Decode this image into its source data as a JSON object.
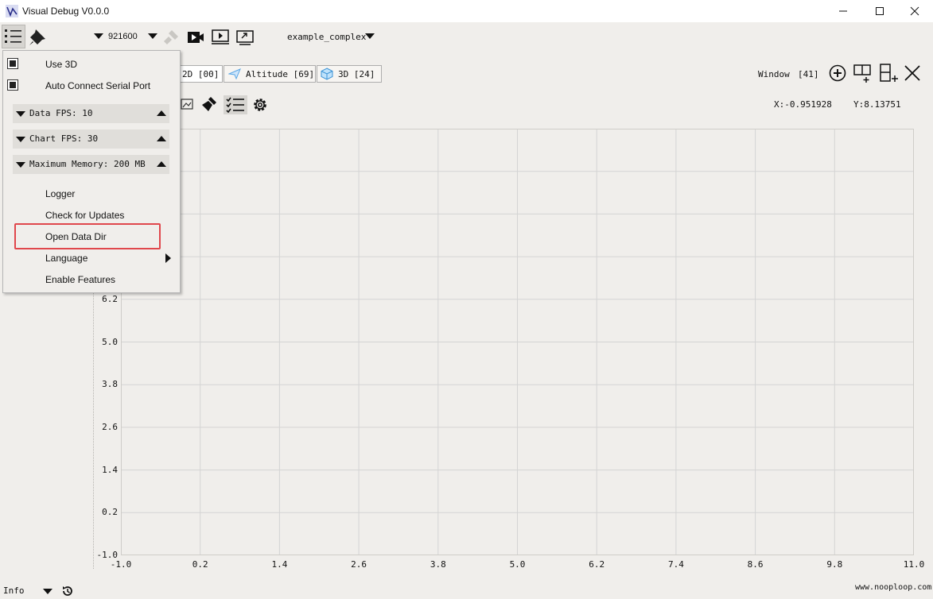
{
  "window": {
    "title": "Visual Debug V0.0.0"
  },
  "toolbar": {
    "baud_rate": "921600",
    "config": "example_complex"
  },
  "tabs": [
    {
      "label": "2D [00]"
    },
    {
      "label": "Altitude [69]"
    },
    {
      "label": "3D [24]"
    }
  ],
  "view": {
    "window_label": "Window",
    "window_count": "[41]",
    "x_readout": "X:-0.951928",
    "y_readout": "Y:8.13751"
  },
  "chart_data": {
    "type": "line",
    "x_ticks": [
      "-1.0",
      "0.2",
      "1.4",
      "2.6",
      "3.8",
      "5.0",
      "6.2",
      "7.4",
      "8.6",
      "9.8",
      "11.0"
    ],
    "y_ticks": [
      "-1.0",
      "0.2",
      "1.4",
      "2.6",
      "3.8",
      "5.0",
      "6.2"
    ],
    "xlim": [
      -1.0,
      11.0
    ],
    "ylim": [
      -1.0,
      11.0
    ],
    "grid": true,
    "series": []
  },
  "menu": {
    "use_3d": "Use 3D",
    "auto_connect": "Auto Connect Serial Port",
    "data_fps": "Data FPS: 10",
    "chart_fps": "Chart FPS: 30",
    "max_memory": "Maximum Memory: 200 MB",
    "logger": "Logger",
    "check_updates": "Check for Updates",
    "open_data_dir": "Open Data Dir",
    "language": "Language",
    "enable_features": "Enable Features"
  },
  "status": {
    "log_level": "Info",
    "website": "www.nooploop.com"
  },
  "colors": {
    "highlight": "#e0474c",
    "grid": "#d4d4d4"
  }
}
